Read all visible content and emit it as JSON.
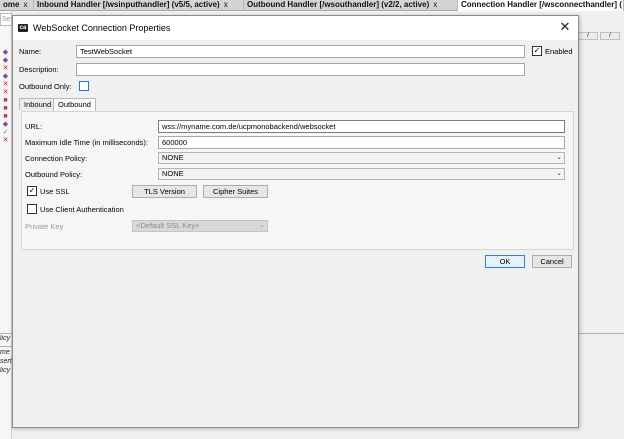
{
  "background": {
    "tabs": [
      {
        "label": "ome",
        "close": "x"
      },
      {
        "label": "Inbound Handler [/wsinputhandler] (v5/5, active)",
        "close": "x"
      },
      {
        "label": "Outbound Handler [/wsouthandler] (v2/2, active)",
        "close": "x"
      },
      {
        "label": "Connection Handler [/wsconnecthandler] (",
        "close": ""
      }
    ],
    "search_placeholder": "Se",
    "bottom_texts": [
      "licy",
      "me",
      "sert",
      "licy"
    ]
  },
  "dialog": {
    "title": "WebSocket Connection Properties",
    "logo_text": "ca",
    "close_symbol": "✕",
    "name_label": "Name:",
    "name_value": "TestWebSocket",
    "enabled_label": "Enabled",
    "enabled_checked": true,
    "description_label": "Description:",
    "description_value": "",
    "outbound_only_label": "Outbound Only:",
    "outbound_only_checked": false,
    "tabs": [
      {
        "label": "Inbound",
        "active": false
      },
      {
        "label": "Outbound",
        "active": true
      }
    ],
    "outbound": {
      "url_label": "URL:",
      "url_value": "wss://myname.com.de/ucpmonobackend/websocket",
      "idle_label": "Maximum Idle Time (in milliseconds):",
      "idle_value": "600000",
      "connection_policy_label": "Connection Policy:",
      "connection_policy_value": "NONE",
      "outbound_policy_label": "Outbound Policy:",
      "outbound_policy_value": "NONE",
      "use_ssl_label": "Use SSL",
      "use_ssl_checked": true,
      "tls_version_button": "TLS Version",
      "cipher_suites_button": "Cipher Suites",
      "client_auth_label": "Use Client Authentication",
      "client_auth_checked": false,
      "private_key_label": "Private Key",
      "private_key_value": "<Default SSL Key>"
    },
    "ok_label": "OK",
    "cancel_label": "Cancel"
  }
}
